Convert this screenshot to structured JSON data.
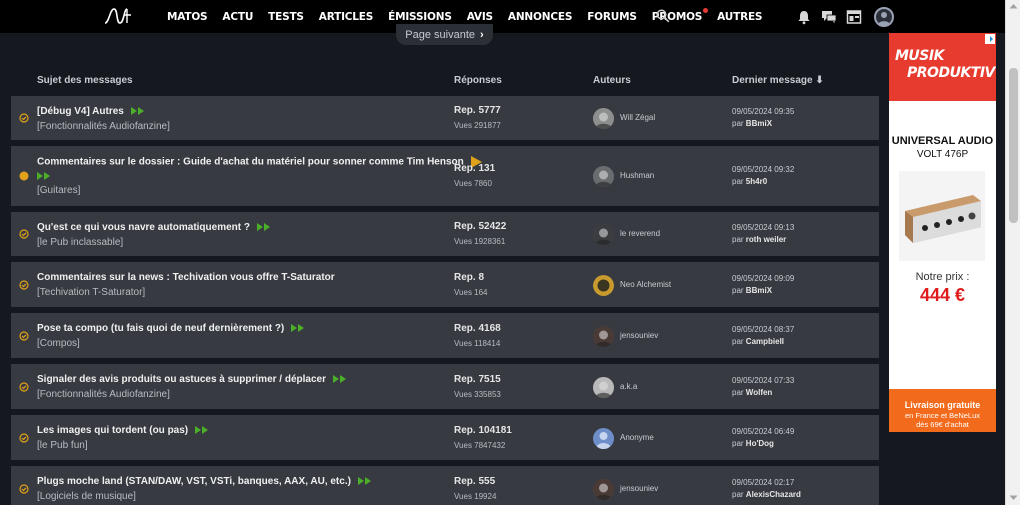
{
  "nav": {
    "items": [
      "MATOS",
      "ACTU",
      "TESTS",
      "ARTICLES",
      "ÉMISSIONS",
      "AVIS",
      "ANNONCES",
      "FORUMS",
      "PROMOS",
      "AUTRES"
    ]
  },
  "pager": {
    "next_label": "Page suivante"
  },
  "columns": {
    "subject": "Sujet des messages",
    "replies": "Réponses",
    "authors": "Auteurs",
    "last": "Dernier message ⬇"
  },
  "topics": [
    {
      "title": "[Débug V4] Autres",
      "forum": "[Fonctionnalités Audiofanzine]",
      "rep": "Rep. 5777",
      "views": "Vues 291877",
      "author": "Will Zégal",
      "date": "09/05/2024 09:35",
      "by_prefix": "par",
      "by": "BBmiX",
      "status": "read"
    },
    {
      "title": "Commentaires sur le dossier : Guide d'achat du matériel pour sonner comme Tim Henson",
      "forum": "[Guitares]",
      "rep": "Rep. 131",
      "views": "Vues 7860",
      "author": "Hushman",
      "date": "09/05/2024 09:32",
      "by_prefix": "par",
      "by": "5h4r0",
      "status": "unread"
    },
    {
      "title": "Qu'est ce qui vous navre automatiquement ?",
      "forum": "[le Pub inclassable]",
      "rep": "Rep. 52422",
      "views": "Vues 1928361",
      "author": "le reverend",
      "date": "09/05/2024 09:13",
      "by_prefix": "par",
      "by": "roth weiler",
      "status": "read"
    },
    {
      "title": "Commentaires sur la news : Techivation vous offre T-Saturator",
      "forum": "[Techivation T-Saturator]",
      "rep": "Rep. 8",
      "views": "Vues 164",
      "author": "Neo Alchemist",
      "date": "09/05/2024 09:09",
      "by_prefix": "par",
      "by": "BBmiX",
      "status": "read"
    },
    {
      "title": "Pose ta compo (tu fais quoi de neuf dernièrement ?)",
      "forum": "[Compos]",
      "rep": "Rep. 4168",
      "views": "Vues 118414",
      "author": "jensouniev",
      "date": "09/05/2024 08:37",
      "by_prefix": "par",
      "by": "Campbiell",
      "status": "read"
    },
    {
      "title": "Signaler des avis produits ou astuces à supprimer / déplacer",
      "forum": "[Fonctionnalités Audiofanzine]",
      "rep": "Rep. 7515",
      "views": "Vues 335853",
      "author": "a.k.a",
      "date": "09/05/2024 07:33",
      "by_prefix": "par",
      "by": "Wolfen",
      "status": "read"
    },
    {
      "title": "Les images qui tordent (ou pas)",
      "forum": "[le Pub fun]",
      "rep": "Rep. 104181",
      "views": "Vues 7847432",
      "author": "Anonyme",
      "date": "09/05/2024 06:49",
      "by_prefix": "par",
      "by": "Ho'Dog",
      "status": "read"
    },
    {
      "title": "Plugs moche land (STAN/DAW, VST, VSTi, banques, AAX, AU, etc.)",
      "forum": "[Logiciels de musique]",
      "rep": "Rep. 555",
      "views": "Vues 19924",
      "author": "jensouniev",
      "date": "09/05/2024 02:17",
      "by_prefix": "par",
      "by": "AlexisChazard",
      "status": "read"
    }
  ],
  "ad": {
    "logo_line1": "MUSIK",
    "logo_line2": "PRODUKTIV",
    "brand": "UNIVERSAL AUDIO",
    "model": "VOLT 476P",
    "price_label": "Notre prix :",
    "price": "444 €",
    "footer_title": "Livraison gratuite",
    "footer_line1": "en France et BeNeLux",
    "footer_line2": "dès 69€ d'achat"
  },
  "colors": {
    "accent_green": "#4caf2a",
    "accent_orange": "#e0a21a",
    "row_bg": "#373a40",
    "page_bg": "#15181e",
    "ad_red": "#e63b2e",
    "ad_orange": "#f26a1b"
  }
}
